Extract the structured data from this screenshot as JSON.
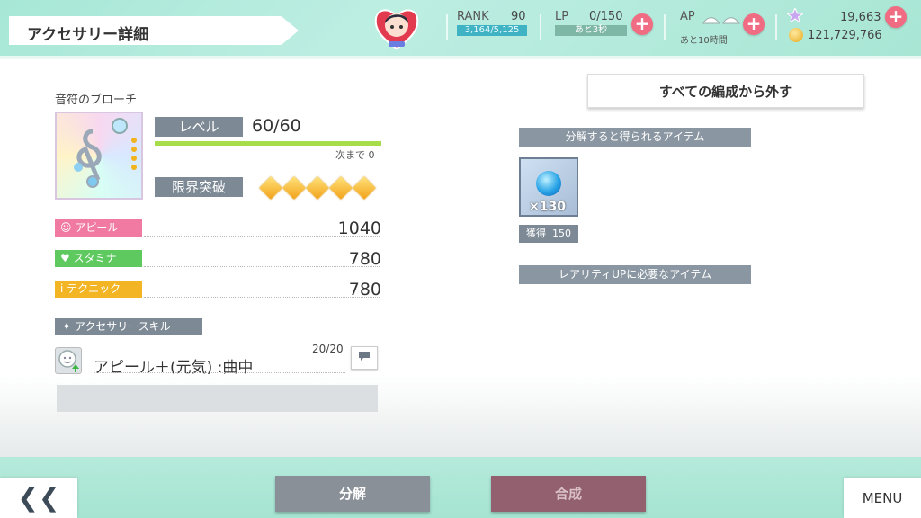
{
  "header": {
    "title": "アクセサリー詳細",
    "rank": {
      "label": "RANK",
      "value": "90",
      "exp": "3,164/5,125"
    },
    "lp": {
      "label": "LP",
      "value": "0/150",
      "timer": "あと3秒"
    },
    "ap": {
      "label": "AP",
      "timer": "あと10時間"
    },
    "currency": {
      "gems": "19,663",
      "gold": "121,729,766"
    },
    "plus": "+"
  },
  "item": {
    "name": "音符のブローチ",
    "level_label": "レベル",
    "level": "60/60",
    "next_label": "次まで 0",
    "limit_break_label": "限界突破",
    "limit_break_stars": 5
  },
  "stats": [
    {
      "label": "アピール",
      "value": "1040",
      "color": "#f07aa2"
    },
    {
      "label": "スタミナ",
      "value": "780",
      "color": "#5dc95e"
    },
    {
      "label": "テクニック",
      "value": "780",
      "color": "#f3b523"
    }
  ],
  "skill": {
    "section_label": "アクセサリースキル",
    "name": "アピール＋(元気) :曲中",
    "level": "20/20"
  },
  "right": {
    "remove_button": "すべての編成から外す",
    "decompose_section": "分解すると得られるアイテム",
    "material_count": "×130",
    "gain_label": "獲得",
    "gain_value": "150",
    "rarity_section": "レアリティUPに必要なアイテム"
  },
  "footer": {
    "back": "❮❮",
    "decompose": "分解",
    "combine": "合成",
    "menu": "MENU"
  }
}
